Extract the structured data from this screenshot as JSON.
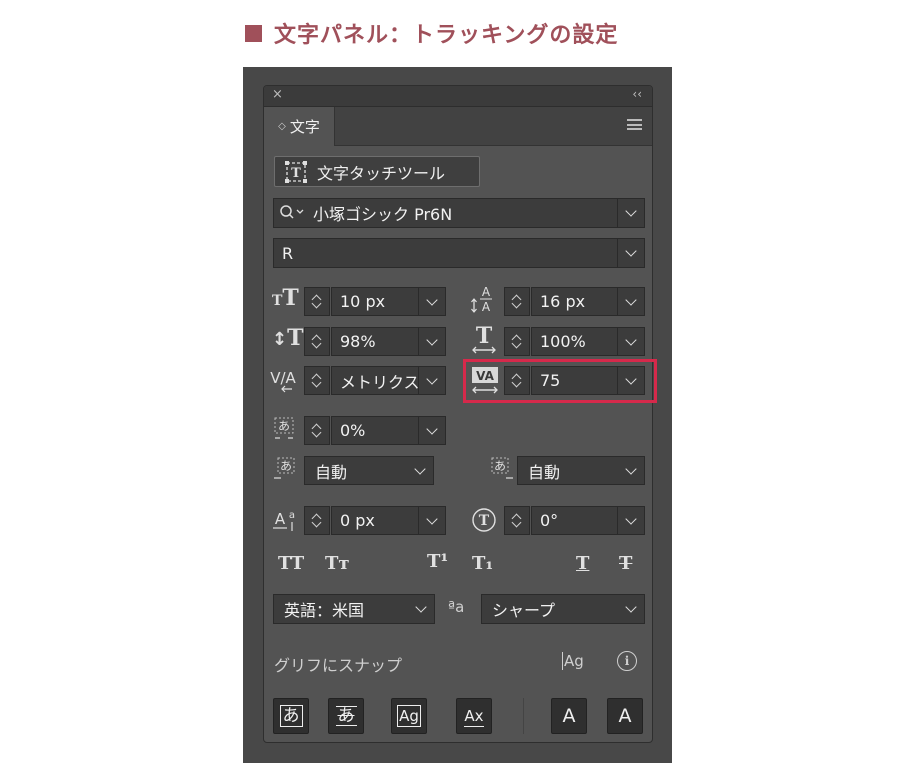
{
  "heading": "文字パネル：トラッキングの設定",
  "panel": {
    "close": "×",
    "collapse": "‹‹",
    "tab_label": "文字",
    "touch_tool": "文字タッチツール",
    "font_family": "小塚ゴシック Pr6N",
    "font_style": "R",
    "size": "10 px",
    "leading": "16 px",
    "vscale": "98%",
    "hscale": "100%",
    "kerning": "メトリクス",
    "tracking": "75",
    "tsume": "0%",
    "aki_before": "自動",
    "aki_after": "自動",
    "baseline": "0 px",
    "rotation": "0°",
    "language": "英語：米国",
    "antialias": "シャープ",
    "aa_icon": "ªa",
    "snap_label": "グリフにスナップ",
    "snap_icons": [
      "Ag",
      "i"
    ],
    "bottom_buttons": [
      "あ",
      "あ",
      "Ag",
      "Ax",
      "A",
      "A"
    ],
    "style_buttons": [
      "TT",
      "Tт",
      "T¹",
      "T₁",
      "T",
      "T"
    ]
  },
  "colors": {
    "accent": "#d6294b",
    "heading": "#a0505a"
  }
}
